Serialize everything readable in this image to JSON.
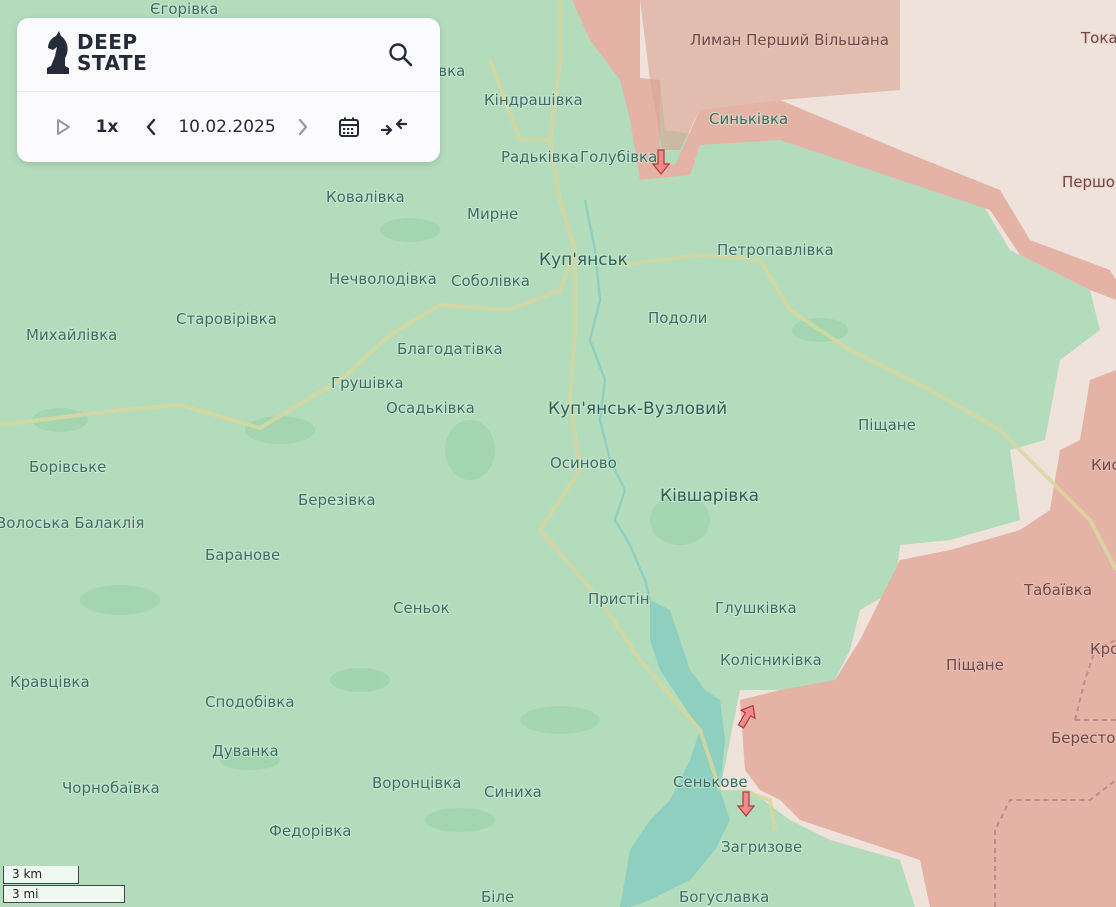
{
  "logo": {
    "line1": "DEEP",
    "line2": "STATE"
  },
  "controls": {
    "speed": "1x",
    "date": "10.02.2025"
  },
  "scale": {
    "km": "3 km",
    "mi": "3 mi"
  },
  "colors": {
    "free": "#b3dcbd",
    "occupied": "#e4b3a6",
    "grey_zone": "#efe2da",
    "water": "#8fcfbf",
    "roads": "#d7d7a0",
    "arrow": "#ef8a8a"
  },
  "places": [
    {
      "name": "Єгорівка"
    },
    {
      "name": "Лиман Перший Вільшана"
    },
    {
      "name": "Тока"
    },
    {
      "name": "ківка"
    },
    {
      "name": "Кіндрашівка"
    },
    {
      "name": "Синьківка"
    },
    {
      "name": "Радьківка"
    },
    {
      "name": "Голубівка"
    },
    {
      "name": "Першо"
    },
    {
      "name": "Ковалівка"
    },
    {
      "name": "Мирне"
    },
    {
      "name": "Куп'янськ"
    },
    {
      "name": "Петропавлівка"
    },
    {
      "name": "Нечволодівка"
    },
    {
      "name": "Соболівка"
    },
    {
      "name": "Старовірівка"
    },
    {
      "name": "Подоли"
    },
    {
      "name": "Михайлівка"
    },
    {
      "name": "Благодатівка"
    },
    {
      "name": "Грушівка"
    },
    {
      "name": "Осадьківка"
    },
    {
      "name": "Куп'янськ-Вузловий"
    },
    {
      "name": "Піщане"
    },
    {
      "name": "Борівське"
    },
    {
      "name": "Осиново"
    },
    {
      "name": "Кис"
    },
    {
      "name": "Ківшарівка"
    },
    {
      "name": "Березівка"
    },
    {
      "name": "Волоська Балаклія"
    },
    {
      "name": "Баранове"
    },
    {
      "name": "Табаївка"
    },
    {
      "name": "Пристін"
    },
    {
      "name": "Сеньок"
    },
    {
      "name": "Глушківка"
    },
    {
      "name": "Кро"
    },
    {
      "name": "Колісниківка"
    },
    {
      "name": "Піщане"
    },
    {
      "name": "Кравцівка"
    },
    {
      "name": "Сподобівка"
    },
    {
      "name": "Берестов"
    },
    {
      "name": "Дуванка"
    },
    {
      "name": "Чорнобаївка"
    },
    {
      "name": "Сенькове"
    },
    {
      "name": "Воронцівка"
    },
    {
      "name": "Синиха"
    },
    {
      "name": "Федорівка"
    },
    {
      "name": "Загризове"
    },
    {
      "name": "Біле"
    },
    {
      "name": "Богуславка"
    }
  ]
}
